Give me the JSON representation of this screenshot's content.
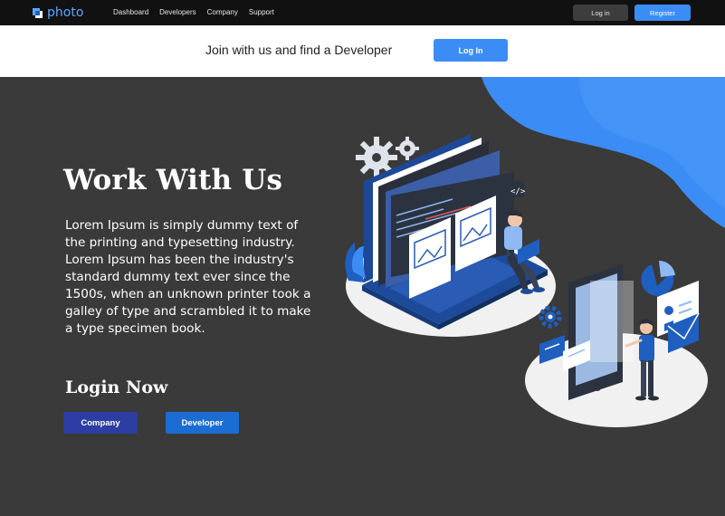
{
  "brand": {
    "name": "photo"
  },
  "nav": {
    "links": [
      "Dashboard",
      "Developers",
      "Company",
      "Support"
    ],
    "login_label": "Log in",
    "register_label": "Register"
  },
  "banner": {
    "text": "Join with us and find a Developer",
    "login_label": "Log In"
  },
  "hero": {
    "title": "Work With Us",
    "body": "Lorem Ipsum is simply dummy text of the printing and typesetting industry. Lorem Ipsum has been the industry's standard dummy text ever since the 1500s, when an unknown printer took a galley of type and scrambled it to make a type specimen book.",
    "login_heading": "Login Now",
    "company_label": "Company",
    "developer_label": "Developer"
  },
  "colors": {
    "accent": "#3b8df5",
    "company_button": "#2c3ea3",
    "developer_button": "#1b6dd3",
    "background": "#3a3a3a"
  },
  "illustration": {
    "icon": "developer-laptop-illustration"
  }
}
